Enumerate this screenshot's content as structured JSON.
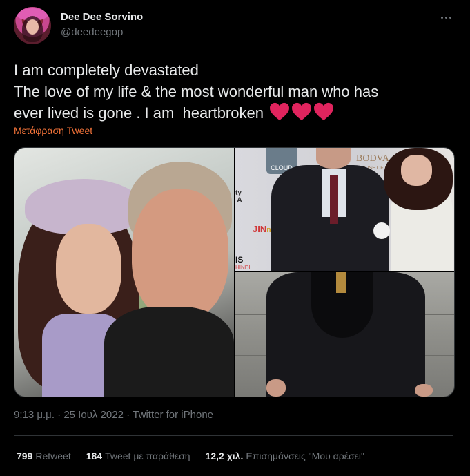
{
  "author": {
    "name": "Dee Dee Sorvino",
    "handle": "@deedeegop",
    "avatar_icon": "profile-avatar"
  },
  "tweet": {
    "lines": [
      "I am completely devastated",
      "The love of my life & the most wonderful man who has",
      "ever lived is gone . I am  heartbroken"
    ],
    "emoji": [
      "red-heart",
      "red-heart",
      "red-heart"
    ],
    "translate_label": "Μετάφραση Tweet"
  },
  "media_text": {
    "sign_cloud": "CLOUD",
    "sign_bodva": "BODVA",
    "sign_bodva_sub": "HOUSE OF HO",
    "sign_jin": "JIN",
    "sign_jin_tail": "mo",
    "sign_ty": "ty",
    "sign_ty2": "A",
    "sign_is": "IS",
    "sign_hindi": "HINDI"
  },
  "meta": {
    "time": "9:13 μ.μ.",
    "separator": "·",
    "date": "25 Ιουλ 2022",
    "source": "Twitter for iPhone"
  },
  "stats": {
    "retweets_count": "799",
    "retweets_label": "Retweet",
    "quotes_count": "184",
    "quotes_label": "Tweet με παράθεση",
    "likes_count": "12,2 χιλ.",
    "likes_label": "Επισημάνσεις \"Μου αρέσει\""
  },
  "colors": {
    "background": "#000000",
    "text": "#e7e9ea",
    "secondary": "#71767b",
    "accent": "#f7753a",
    "heart": "#e0245e"
  }
}
